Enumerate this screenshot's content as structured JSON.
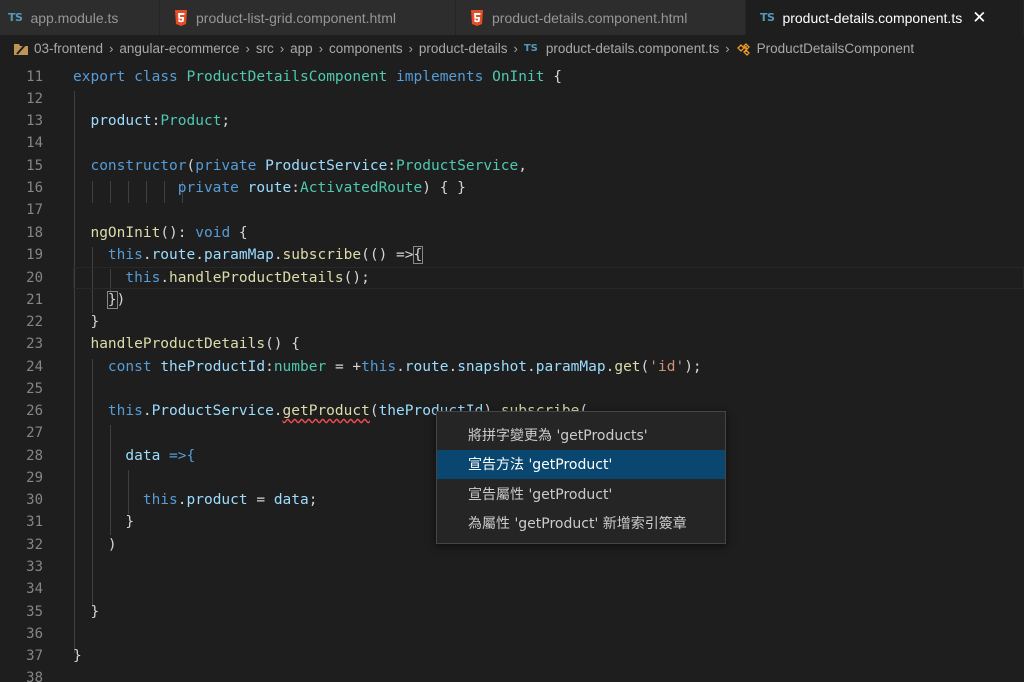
{
  "tabs": [
    {
      "label": "app.module.ts",
      "icon": "typescript-icon",
      "active": false
    },
    {
      "label": "product-list-grid.component.html",
      "icon": "html5-icon",
      "active": false
    },
    {
      "label": "product-details.component.html",
      "icon": "html5-icon",
      "active": false
    },
    {
      "label": "product-details.component.ts",
      "icon": "typescript-icon",
      "active": true
    }
  ],
  "tab_close_glyph": "✕",
  "breadcrumb": {
    "items": [
      "03-frontend",
      "angular-ecommerce",
      "src",
      "app",
      "components",
      "product-details",
      "product-details.component.ts",
      "ProductDetailsComponent"
    ],
    "ts_label": "TS"
  },
  "icons": {
    "ts_label": "TS"
  },
  "colors": {
    "editor_bg": "#1e1e1e",
    "keyword": "#569cd6",
    "type": "#4ec9b0",
    "function": "#dcdcaa",
    "variable": "#9cdcfe",
    "string": "#ce9178",
    "menu_selected": "#094771",
    "error_squiggle": "#f14c4c"
  },
  "editor": {
    "current_line": 20,
    "lines": [
      {
        "n": "11"
      },
      {
        "n": "12"
      },
      {
        "n": "13"
      },
      {
        "n": "14"
      },
      {
        "n": "15"
      },
      {
        "n": "16"
      },
      {
        "n": "17"
      },
      {
        "n": "18"
      },
      {
        "n": "19"
      },
      {
        "n": "20"
      },
      {
        "n": "21"
      },
      {
        "n": "22"
      },
      {
        "n": "23"
      },
      {
        "n": "24"
      },
      {
        "n": "25"
      },
      {
        "n": "26"
      },
      {
        "n": "27"
      },
      {
        "n": "28"
      },
      {
        "n": "29"
      },
      {
        "n": "30"
      },
      {
        "n": "31"
      },
      {
        "n": "32"
      },
      {
        "n": "33"
      },
      {
        "n": "34"
      },
      {
        "n": "35"
      },
      {
        "n": "36"
      },
      {
        "n": "37"
      },
      {
        "n": "38"
      }
    ],
    "tokens": {
      "l11": [
        "export",
        "class",
        "ProductDetailsComponent",
        "implements",
        "OnInit",
        "{"
      ],
      "l13": [
        "product",
        ":",
        "Product",
        ";"
      ],
      "l15": [
        "constructor",
        "(",
        "private",
        "ProductService",
        ":",
        "ProductService",
        ","
      ],
      "l16": [
        "private",
        "route",
        ":",
        "ActivatedRoute",
        ")",
        "{ }"
      ],
      "l18": [
        "ngOnInit",
        "():",
        "void",
        "{"
      ],
      "l19": [
        "this",
        ".",
        "route",
        ".",
        "paramMap",
        ".",
        "subscribe",
        "(() =>",
        "{"
      ],
      "l20": [
        "this",
        ".",
        "handleProductDetails",
        "();"
      ],
      "l21": [
        "}",
        ")"
      ],
      "l22": [
        "}"
      ],
      "l23": [
        "handleProductDetails",
        "() {"
      ],
      "l24": [
        "const",
        "theProductId",
        ":",
        "number",
        "= +",
        "this",
        ".",
        "route",
        ".",
        "snapshot",
        ".",
        "paramMap",
        ".",
        "get",
        "(",
        "'id'",
        ");"
      ],
      "l26": [
        "this",
        ".",
        "ProductService",
        ".",
        "getProduct",
        "(",
        "theProductId",
        ").",
        "subscribe",
        "("
      ],
      "l28": [
        "data",
        " =>{"
      ],
      "l30": [
        "this",
        ".",
        "product",
        " = ",
        "data",
        ";"
      ],
      "l31": [
        "}"
      ],
      "l32": [
        ")"
      ],
      "l35": [
        "}"
      ],
      "l37": [
        "}"
      ]
    }
  },
  "context_menu": {
    "items": [
      {
        "label": "將拼字變更為 'getProducts'",
        "selected": false
      },
      {
        "label": "宣告方法 'getProduct'",
        "selected": true
      },
      {
        "label": "宣告屬性 'getProduct'",
        "selected": false
      },
      {
        "label": "為屬性 'getProduct' 新增索引簽章",
        "selected": false
      }
    ]
  }
}
